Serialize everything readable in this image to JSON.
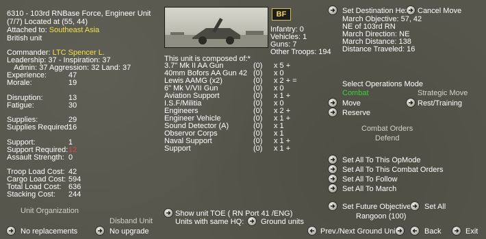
{
  "unit": {
    "header_line": "6310 - 103rd RNBase Force, Engineer Unit",
    "location_line": "(7/7) Located at (55, 44)",
    "attached_label": "Attached to:",
    "attached_value": "Southeast Asia",
    "nationality": "British unit",
    "commander_label": "Commander:",
    "commander_value": "LTC Spencer L.",
    "leadership_line": "Leadership: 37 - Inspiration: 37",
    "admin_line": "Admin: 37  Aggression: 32 Land: 37"
  },
  "stats_top": [
    {
      "label": "Experience:",
      "value": "47"
    },
    {
      "label": "Morale:",
      "value": "19"
    }
  ],
  "stats_disruption": [
    {
      "label": "Disruption:",
      "value": "13"
    },
    {
      "label": "Fatigue:",
      "value": "30"
    }
  ],
  "stats_supplies": [
    {
      "label": "Supplies:",
      "value": "29"
    },
    {
      "label": "Supplies Required:",
      "value": "16"
    }
  ],
  "stats_support": [
    {
      "label": "Support:",
      "value": "1"
    },
    {
      "label": "Support Required:",
      "value": "12"
    },
    {
      "label": "Assault Strength:",
      "value": "0"
    }
  ],
  "stats_load": [
    {
      "label": "Troop Load Cost:",
      "value": "42"
    },
    {
      "label": "Cargo Load Cost:",
      "value": "594"
    },
    {
      "label": "Total Load Cost:",
      "value": "636"
    },
    {
      "label": "Stacking Cost:",
      "value": "244"
    }
  ],
  "org": {
    "unit_org_label": "Unit Organization",
    "disband_label": "Disband Unit",
    "no_replacements": "No replacements",
    "no_upgrade": "No upgrade"
  },
  "badge": "BF",
  "counts": [
    "Infantry: 0",
    "Vehicles: 1",
    "Guns: 7",
    "Other Troops: 194"
  ],
  "composed_title": "This unit is composed of:*",
  "composition": [
    {
      "name": "3.7\" Mk II AA Gun",
      "ready": "(0)",
      "count": "x 5 +"
    },
    {
      "name": "40mm Bofors AA Gun  42",
      "ready": "(0)",
      "count": "x 0"
    },
    {
      "name": "Lewis AAMG (x2)",
      "ready": "(0)",
      "count": "x 2 + ="
    },
    {
      "name": "6\" Mk V/VII Gun",
      "ready": "(0)",
      "count": "x 0"
    },
    {
      "name": "Aviation Support",
      "ready": "(0)",
      "count": "x 1 +"
    },
    {
      "name": "I.S.F/Militia",
      "ready": "(0)",
      "count": "x 0"
    },
    {
      "name": "Engineers",
      "ready": "(0)",
      "count": "x 2 +"
    },
    {
      "name": "Engineer Vehicle",
      "ready": "(0)",
      "count": "x 1 +"
    },
    {
      "name": "Sound Detector (A)",
      "ready": "(0)",
      "count": "x 1"
    },
    {
      "name": "Observor Corps",
      "ready": "(0)",
      "count": "x 1"
    },
    {
      "name": "Naval Support",
      "ready": "(0)",
      "count": "x 1 +"
    },
    {
      "name": "Support",
      "ready": "(0)",
      "count": "x 1 +"
    }
  ],
  "toe_line": "Show unit TOE ( RN Port 41 /ENG)",
  "same_hq_label": "Units with same HQ:",
  "ground_units": "Ground units",
  "destination": {
    "set_dest": "Set Destination Hex",
    "cancel_move": "Cancel Move",
    "march_objective": "March Objective: 57, 42",
    "ne_of": "NE of 103rd RN",
    "march_direction": "March Direction: NE",
    "march_distance": "March Distance:    138",
    "distance_traveled": "Distance Traveled: 16"
  },
  "ops": {
    "title": "Select Operations Mode",
    "combat": "Combat",
    "strategic": "Strategic Move",
    "move": "Move",
    "rest": "Rest/Training",
    "reserve": "Reserve",
    "combat_orders": "Combat Orders",
    "defend": "Defend"
  },
  "set_all": {
    "opmode": "Set All To This OpMode",
    "combat_orders": "Set All To This Combat Orders",
    "follow": "Set All To Follow",
    "march": "Set All To March",
    "future_objective": "Set Future Objective",
    "set_all": "Set All",
    "rangoon": "Rangoon (100)"
  },
  "nav": {
    "prev_next": "Prev./Next Ground Unit",
    "back": "Back",
    "exit": "Exit"
  }
}
